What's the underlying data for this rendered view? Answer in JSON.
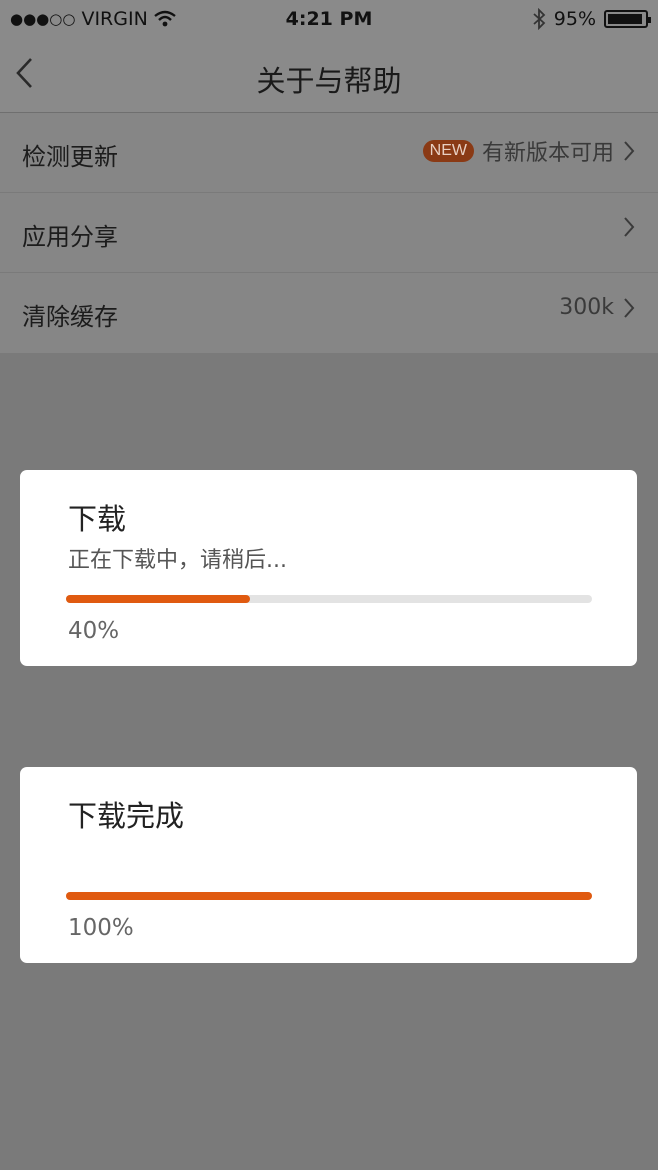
{
  "status_bar": {
    "carrier": "VIRGIN",
    "signal_dots": "●●●○○",
    "time": "4:21 PM",
    "battery": "95%",
    "battery_level": 0.95
  },
  "nav": {
    "title": "关于与帮助",
    "back_icon": "chevron-left-icon"
  },
  "settings": {
    "items": [
      {
        "label": "检测更新",
        "badge": "NEW",
        "value": "有新版本可用"
      },
      {
        "label": "应用分享",
        "value": ""
      },
      {
        "label": "清除缓存",
        "value": "300k"
      }
    ]
  },
  "dialogs": [
    {
      "title": "下载",
      "message": "正在下载中，请稍后...",
      "progress": 0.35,
      "percent_label": "40%"
    },
    {
      "title": "下载完成",
      "message": "",
      "progress": 1.0,
      "percent_label": "100%"
    }
  ],
  "colors": {
    "accent": "#e05a10",
    "overlay": "#7a7a7a",
    "track": "#e3e3e3"
  }
}
